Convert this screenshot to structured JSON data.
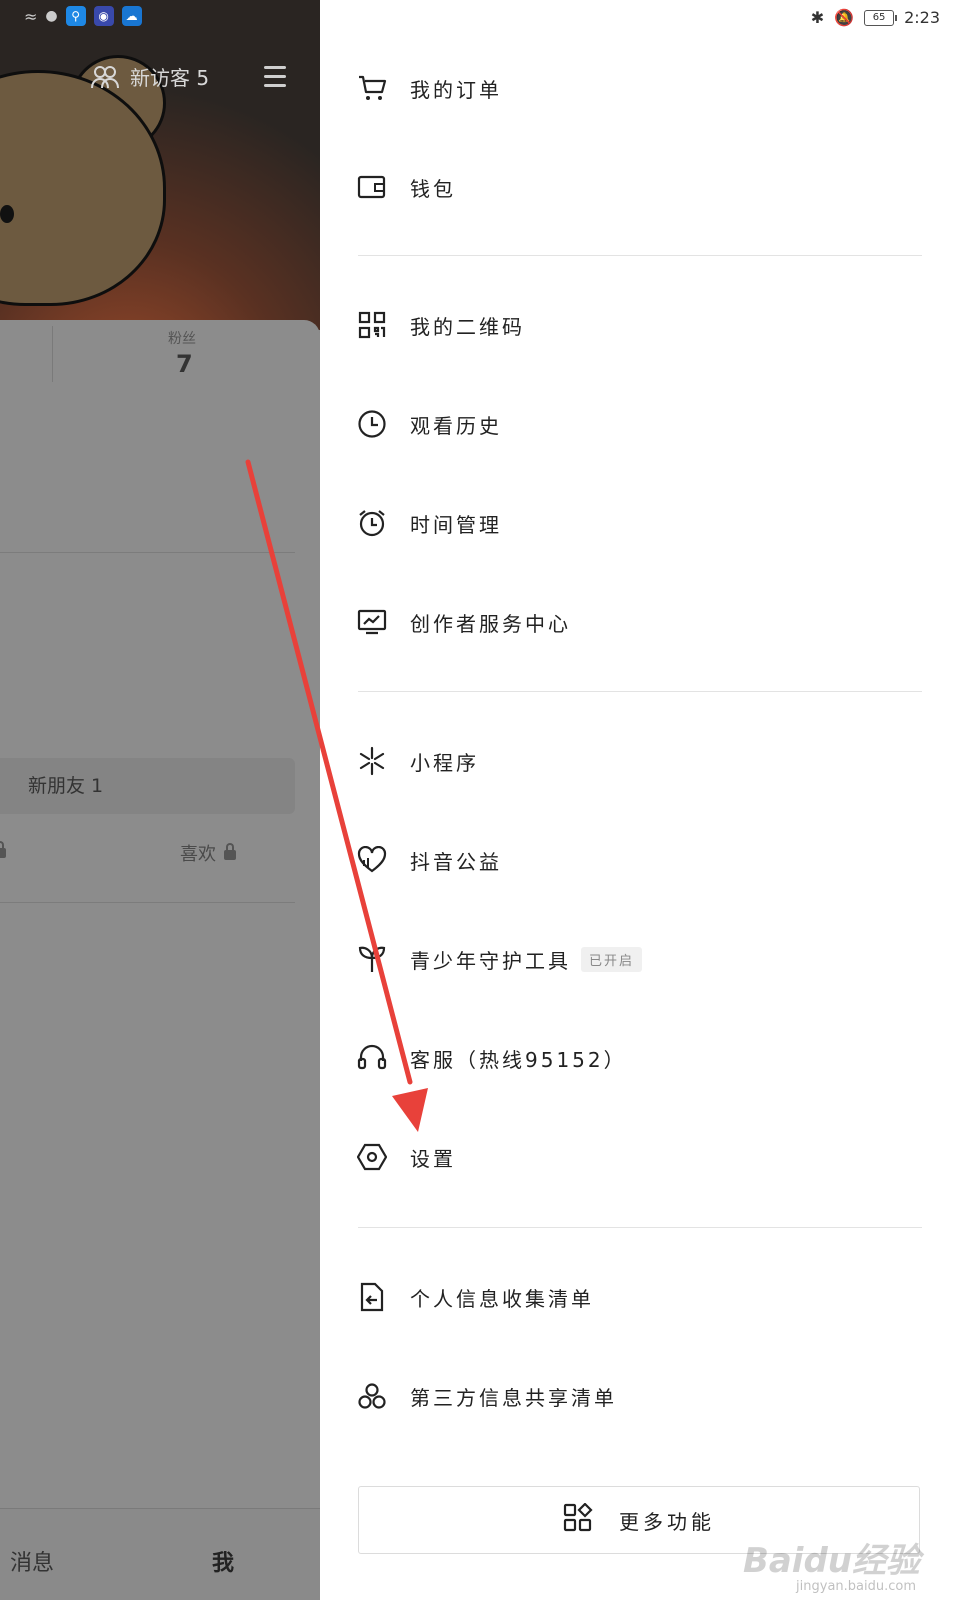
{
  "status_bar": {
    "time": "2:23",
    "battery": "65"
  },
  "profile": {
    "visitors_label": "新访客 5",
    "fans_label": "粉丝",
    "fans_count": "7",
    "new_friends": "新朋友 1",
    "likes_label": "喜欢"
  },
  "bottom_nav": {
    "messages": "消息",
    "me": "我"
  },
  "drawer": {
    "section1": [
      {
        "label": "我的订单",
        "icon": "cart-icon"
      },
      {
        "label": "钱包",
        "icon": "wallet-icon"
      }
    ],
    "section2": [
      {
        "label": "我的二维码",
        "icon": "qrcode-icon"
      },
      {
        "label": "观看历史",
        "icon": "clock-icon"
      },
      {
        "label": "时间管理",
        "icon": "alarm-icon"
      },
      {
        "label": "创作者服务中心",
        "icon": "monitor-chart-icon"
      }
    ],
    "section3": [
      {
        "label": "小程序",
        "icon": "mini-program-icon"
      },
      {
        "label": "抖音公益",
        "icon": "heart-icon"
      },
      {
        "label": "青少年守护工具",
        "icon": "sprout-icon",
        "tag": "已开启"
      },
      {
        "label": "客服（热线95152）",
        "icon": "headset-icon"
      },
      {
        "label": "设置",
        "icon": "settings-hexagon-icon"
      }
    ],
    "section4": [
      {
        "label": "个人信息收集清单",
        "icon": "document-arrow-icon"
      },
      {
        "label": "第三方信息共享清单",
        "icon": "share-circles-icon"
      }
    ],
    "more_button": "更多功能"
  },
  "watermark": {
    "main": "Baidu经验",
    "sub": "jingyan.baidu.com"
  },
  "colors": {
    "arrow": "#e8413a",
    "overlay": "#8a8a8a"
  }
}
